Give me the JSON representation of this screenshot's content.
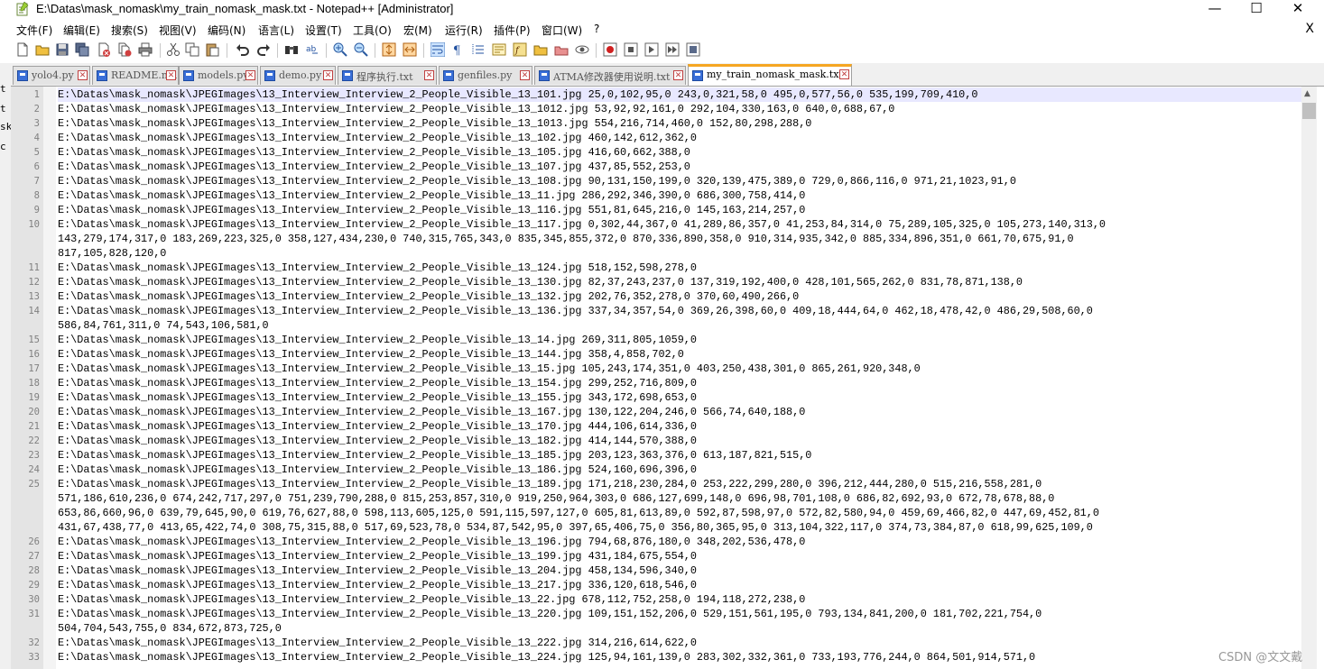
{
  "window": {
    "title": "E:\\Datas\\mask_nomask\\my_train_nomask_mask.txt - Notepad++ [Administrator]",
    "minimize": "—",
    "maximize": "☐",
    "close": "✕"
  },
  "menu": {
    "items": [
      "文件(F)",
      "编辑(E)",
      "搜索(S)",
      "视图(V)",
      "编码(N)",
      "语言(L)",
      "设置(T)",
      "工具(O)",
      "宏(M)",
      "运行(R)",
      "插件(P)",
      "窗口(W)",
      "?"
    ],
    "close": "X"
  },
  "toolbar": {
    "icons": [
      "new-file-icon",
      "open-file-icon",
      "save-icon",
      "save-all-icon",
      "close-icon",
      "close-all-icon",
      "print-icon",
      "cut-icon",
      "copy-icon",
      "paste-icon",
      "undo-icon",
      "redo-icon",
      "find-icon",
      "replace-icon",
      "zoom-in-icon",
      "zoom-out-icon",
      "sync-vertical-icon",
      "sync-horizontal-icon",
      "word-wrap-icon",
      "show-all-chars-icon",
      "indent-guide-icon",
      "doc-map-icon",
      "function-list-icon",
      "folder-workspace-icon",
      "monitor-icon",
      "record-macro-icon",
      "stop-record-icon",
      "play-macro-icon",
      "run-macro-multiple-icon",
      "save-macro-icon"
    ]
  },
  "tabs": [
    {
      "label": "yolo4.py",
      "active": false
    },
    {
      "label": "README.md",
      "active": false
    },
    {
      "label": "models.py",
      "active": false
    },
    {
      "label": "demo.py",
      "active": false
    },
    {
      "label": "程序执行.txt",
      "active": false
    },
    {
      "label": "genfiles.py",
      "active": false
    },
    {
      "label": "ATMA修改器使用说明.txt",
      "active": false
    },
    {
      "label": "my_train_nomask_mask.txt",
      "active": true
    }
  ],
  "left_strip": [
    "t",
    "t",
    "sk",
    "c"
  ],
  "editor": {
    "lines": [
      {
        "n": "1",
        "segments": [
          "E:\\Datas\\mask_nomask\\JPEGImages\\13_Interview_Interview_2_People_Visible_13_101.jpg 25,0,102,95,0 243,0,321,58,0 495,0,577,56,0 535,199,709,410,0"
        ]
      },
      {
        "n": "2",
        "segments": [
          "E:\\Datas\\mask_nomask\\JPEGImages\\13_Interview_Interview_2_People_Visible_13_1012.jpg 53,92,92,161,0 292,104,330,163,0 640,0,688,67,0"
        ]
      },
      {
        "n": "3",
        "segments": [
          "E:\\Datas\\mask_nomask\\JPEGImages\\13_Interview_Interview_2_People_Visible_13_1013.jpg 554,216,714,460,0 152,80,298,288,0"
        ]
      },
      {
        "n": "4",
        "segments": [
          "E:\\Datas\\mask_nomask\\JPEGImages\\13_Interview_Interview_2_People_Visible_13_102.jpg 460,142,612,362,0"
        ]
      },
      {
        "n": "5",
        "segments": [
          "E:\\Datas\\mask_nomask\\JPEGImages\\13_Interview_Interview_2_People_Visible_13_105.jpg 416,60,662,388,0"
        ]
      },
      {
        "n": "6",
        "segments": [
          "E:\\Datas\\mask_nomask\\JPEGImages\\13_Interview_Interview_2_People_Visible_13_107.jpg 437,85,552,253,0"
        ]
      },
      {
        "n": "7",
        "segments": [
          "E:\\Datas\\mask_nomask\\JPEGImages\\13_Interview_Interview_2_People_Visible_13_108.jpg 90,131,150,199,0 320,139,475,389,0 729,0,866,116,0 971,21,1023,91,0"
        ]
      },
      {
        "n": "8",
        "segments": [
          "E:\\Datas\\mask_nomask\\JPEGImages\\13_Interview_Interview_2_People_Visible_13_11.jpg 286,292,346,390,0 686,300,758,414,0"
        ]
      },
      {
        "n": "9",
        "segments": [
          "E:\\Datas\\mask_nomask\\JPEGImages\\13_Interview_Interview_2_People_Visible_13_116.jpg 551,81,645,216,0 145,163,214,257,0"
        ]
      },
      {
        "n": "10",
        "segments": [
          "E:\\Datas\\mask_nomask\\JPEGImages\\13_Interview_Interview_2_People_Visible_13_117.jpg 0,302,44,367,0 41,289,86,357,0 41,253,84,314,0 75,289,105,325,0 105,273,140,313,0",
          "143,279,174,317,0 183,269,223,325,0 358,127,434,230,0 740,315,765,343,0 835,345,855,372,0 870,336,890,358,0 910,314,935,342,0 885,334,896,351,0 661,70,675,91,0",
          "817,105,828,120,0"
        ]
      },
      {
        "n": "11",
        "segments": [
          "E:\\Datas\\mask_nomask\\JPEGImages\\13_Interview_Interview_2_People_Visible_13_124.jpg 518,152,598,278,0"
        ]
      },
      {
        "n": "12",
        "segments": [
          "E:\\Datas\\mask_nomask\\JPEGImages\\13_Interview_Interview_2_People_Visible_13_130.jpg 82,37,243,237,0 137,319,192,400,0 428,101,565,262,0 831,78,871,138,0"
        ]
      },
      {
        "n": "13",
        "segments": [
          "E:\\Datas\\mask_nomask\\JPEGImages\\13_Interview_Interview_2_People_Visible_13_132.jpg 202,76,352,278,0 370,60,490,266,0"
        ]
      },
      {
        "n": "14",
        "segments": [
          "E:\\Datas\\mask_nomask\\JPEGImages\\13_Interview_Interview_2_People_Visible_13_136.jpg 337,34,357,54,0 369,26,398,60,0 409,18,444,64,0 462,18,478,42,0 486,29,508,60,0",
          "586,84,761,311,0 74,543,106,581,0"
        ]
      },
      {
        "n": "15",
        "segments": [
          "E:\\Datas\\mask_nomask\\JPEGImages\\13_Interview_Interview_2_People_Visible_13_14.jpg 269,311,805,1059,0"
        ]
      },
      {
        "n": "16",
        "segments": [
          "E:\\Datas\\mask_nomask\\JPEGImages\\13_Interview_Interview_2_People_Visible_13_144.jpg 358,4,858,702,0"
        ]
      },
      {
        "n": "17",
        "segments": [
          "E:\\Datas\\mask_nomask\\JPEGImages\\13_Interview_Interview_2_People_Visible_13_15.jpg 105,243,174,351,0 403,250,438,301,0 865,261,920,348,0"
        ]
      },
      {
        "n": "18",
        "segments": [
          "E:\\Datas\\mask_nomask\\JPEGImages\\13_Interview_Interview_2_People_Visible_13_154.jpg 299,252,716,809,0"
        ]
      },
      {
        "n": "19",
        "segments": [
          "E:\\Datas\\mask_nomask\\JPEGImages\\13_Interview_Interview_2_People_Visible_13_155.jpg 343,172,698,653,0"
        ]
      },
      {
        "n": "20",
        "segments": [
          "E:\\Datas\\mask_nomask\\JPEGImages\\13_Interview_Interview_2_People_Visible_13_167.jpg 130,122,204,246,0 566,74,640,188,0"
        ]
      },
      {
        "n": "21",
        "segments": [
          "E:\\Datas\\mask_nomask\\JPEGImages\\13_Interview_Interview_2_People_Visible_13_170.jpg 444,106,614,336,0"
        ]
      },
      {
        "n": "22",
        "segments": [
          "E:\\Datas\\mask_nomask\\JPEGImages\\13_Interview_Interview_2_People_Visible_13_182.jpg 414,144,570,388,0"
        ]
      },
      {
        "n": "23",
        "segments": [
          "E:\\Datas\\mask_nomask\\JPEGImages\\13_Interview_Interview_2_People_Visible_13_185.jpg 203,123,363,376,0 613,187,821,515,0"
        ]
      },
      {
        "n": "24",
        "segments": [
          "E:\\Datas\\mask_nomask\\JPEGImages\\13_Interview_Interview_2_People_Visible_13_186.jpg 524,160,696,396,0"
        ]
      },
      {
        "n": "25",
        "segments": [
          "E:\\Datas\\mask_nomask\\JPEGImages\\13_Interview_Interview_2_People_Visible_13_189.jpg 171,218,230,284,0 253,222,299,280,0 396,212,444,280,0 515,216,558,281,0",
          "571,186,610,236,0 674,242,717,297,0 751,239,790,288,0 815,253,857,310,0 919,250,964,303,0 686,127,699,148,0 696,98,701,108,0 686,82,692,93,0 672,78,678,88,0",
          "653,86,660,96,0 639,79,645,90,0 619,76,627,88,0 598,113,605,125,0 591,115,597,127,0 605,81,613,89,0 592,87,598,97,0 572,82,580,94,0 459,69,466,82,0 447,69,452,81,0",
          "431,67,438,77,0 413,65,422,74,0 308,75,315,88,0 517,69,523,78,0 534,87,542,95,0 397,65,406,75,0 356,80,365,95,0 313,104,322,117,0 374,73,384,87,0 618,99,625,109,0"
        ]
      },
      {
        "n": "26",
        "segments": [
          "E:\\Datas\\mask_nomask\\JPEGImages\\13_Interview_Interview_2_People_Visible_13_196.jpg 794,68,876,180,0 348,202,536,478,0"
        ]
      },
      {
        "n": "27",
        "segments": [
          "E:\\Datas\\mask_nomask\\JPEGImages\\13_Interview_Interview_2_People_Visible_13_199.jpg 431,184,675,554,0"
        ]
      },
      {
        "n": "28",
        "segments": [
          "E:\\Datas\\mask_nomask\\JPEGImages\\13_Interview_Interview_2_People_Visible_13_204.jpg 458,134,596,340,0"
        ]
      },
      {
        "n": "29",
        "segments": [
          "E:\\Datas\\mask_nomask\\JPEGImages\\13_Interview_Interview_2_People_Visible_13_217.jpg 336,120,618,546,0"
        ]
      },
      {
        "n": "30",
        "segments": [
          "E:\\Datas\\mask_nomask\\JPEGImages\\13_Interview_Interview_2_People_Visible_13_22.jpg 678,112,752,258,0 194,118,272,238,0"
        ]
      },
      {
        "n": "31",
        "segments": [
          "E:\\Datas\\mask_nomask\\JPEGImages\\13_Interview_Interview_2_People_Visible_13_220.jpg 109,151,152,206,0 529,151,561,195,0 793,134,841,200,0 181,702,221,754,0",
          "504,704,543,755,0 834,672,873,725,0"
        ]
      },
      {
        "n": "32",
        "segments": [
          "E:\\Datas\\mask_nomask\\JPEGImages\\13_Interview_Interview_2_People_Visible_13_222.jpg 314,216,614,622,0"
        ]
      },
      {
        "n": "33",
        "segments": [
          "E:\\Datas\\mask_nomask\\JPEGImages\\13_Interview_Interview_2_People_Visible_13_224.jpg 125,94,161,139,0 283,302,332,361,0 733,193,776,244,0 864,501,914,571,0"
        ]
      }
    ]
  },
  "scrollbar": {
    "up_arrow": "▲"
  },
  "watermark": "CSDN @文文戴"
}
